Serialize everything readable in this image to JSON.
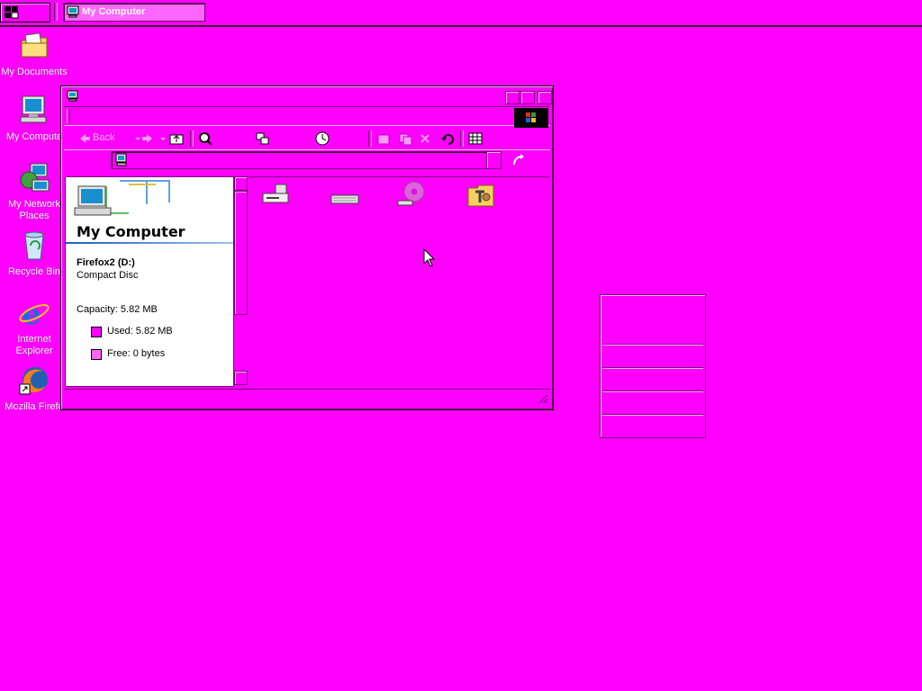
{
  "taskbar": {
    "start_label": "",
    "tasks": [
      {
        "label": "My Computer"
      }
    ]
  },
  "desktop": {
    "icons": [
      {
        "label": "My Documents",
        "icon": "folder-documents-icon"
      },
      {
        "label": "My Compute",
        "icon": "my-computer-icon"
      },
      {
        "label": "My Network Places",
        "icon": "network-places-icon"
      },
      {
        "label": "Recycle Bin",
        "icon": "recycle-bin-icon"
      },
      {
        "label": "Internet Explorer",
        "icon": "internet-explorer-icon"
      },
      {
        "label": "Mozilla Firefo",
        "icon": "firefox-icon"
      }
    ]
  },
  "window": {
    "title": "",
    "toolbar": {
      "back_label": "Back"
    },
    "address": {
      "value": ""
    },
    "info_pane": {
      "title": "My Computer",
      "drive_name": "Firefox2 (D:)",
      "drive_type": "Compact Disc",
      "capacity": "Capacity: 5.82 MB",
      "used": "Used: 5.82 MB",
      "free": "Free: 0 bytes",
      "used_color": "#ff00ff",
      "free_color": "#ff66ff"
    },
    "drives": [
      {
        "icon": "floppy-drive-icon"
      },
      {
        "icon": "hard-disk-icon"
      },
      {
        "icon": "cd-drive-icon"
      },
      {
        "icon": "control-panel-folder-icon"
      }
    ]
  },
  "colors": {
    "desktop_background": "#ff00ff",
    "highlight": "#ff66ff"
  }
}
